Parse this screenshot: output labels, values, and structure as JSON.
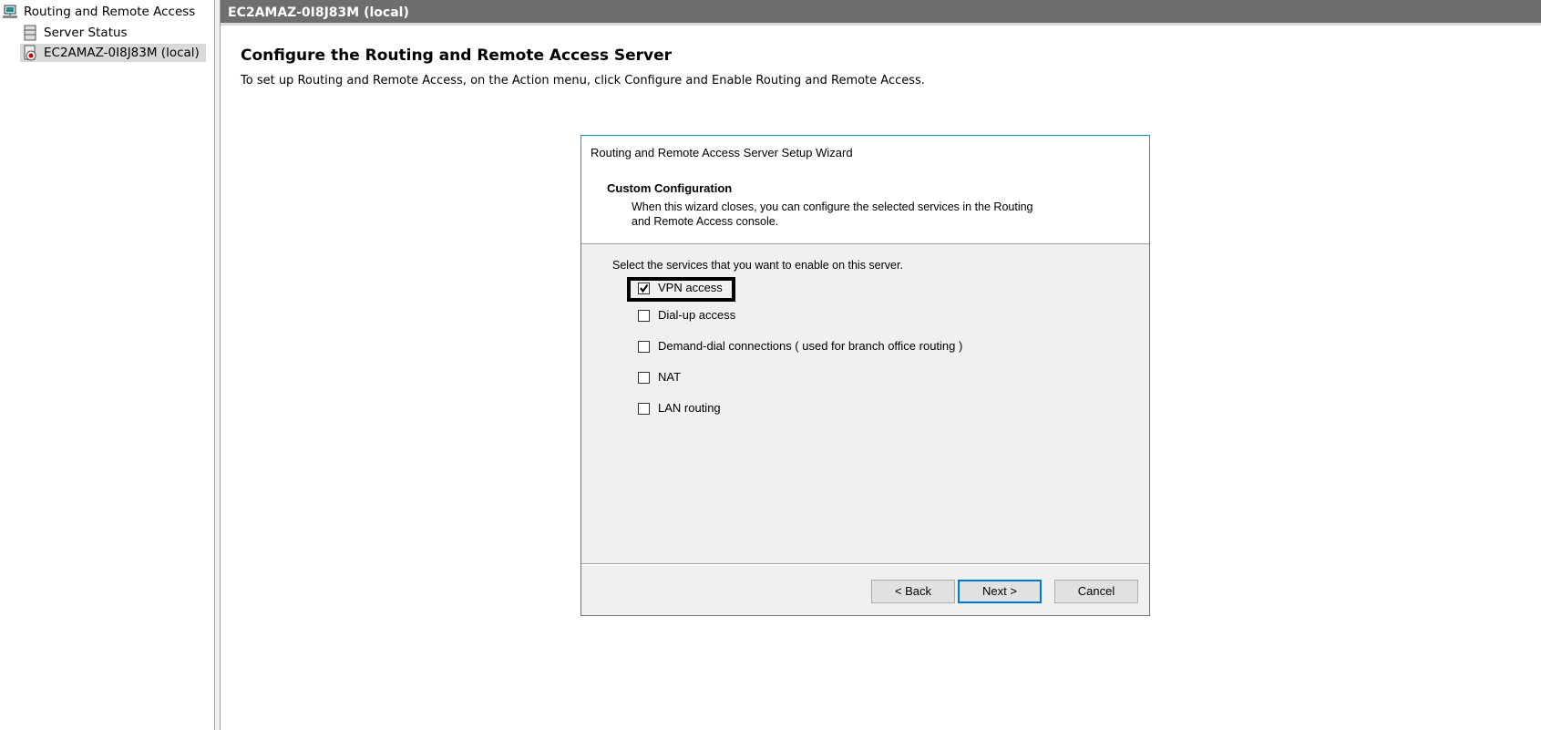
{
  "tree": {
    "root": "Routing and Remote Access",
    "items": [
      {
        "label": "Server Status",
        "icon": "server-status-icon"
      },
      {
        "label": "EC2AMAZ-0I8J83M (local)",
        "icon": "server-stopped-icon",
        "selected": true
      }
    ]
  },
  "header": {
    "title": "EC2AMAZ-0I8J83M (local)"
  },
  "main": {
    "title": "Configure the Routing and Remote Access Server",
    "subtitle": "To set up Routing and Remote Access, on the Action menu, click Configure and Enable Routing and Remote Access."
  },
  "wizard": {
    "title": "Routing and Remote Access Server Setup Wizard",
    "section_title": "Custom Configuration",
    "description_line1": "When this wizard closes, you can configure the selected services in the Routing",
    "description_line2": "and Remote Access console.",
    "prompt": "Select the services that you want to enable on this server.",
    "options": [
      {
        "label": "VPN access",
        "checked": true
      },
      {
        "label": "Dial-up access",
        "checked": false
      },
      {
        "label": "Demand-dial connections ( used for branch office routing )",
        "checked": false
      },
      {
        "label": "NAT",
        "checked": false
      },
      {
        "label": "LAN routing",
        "checked": false
      }
    ],
    "buttons": {
      "back": "< Back",
      "next": "Next >",
      "cancel": "Cancel"
    },
    "accent": "#0078d7"
  }
}
